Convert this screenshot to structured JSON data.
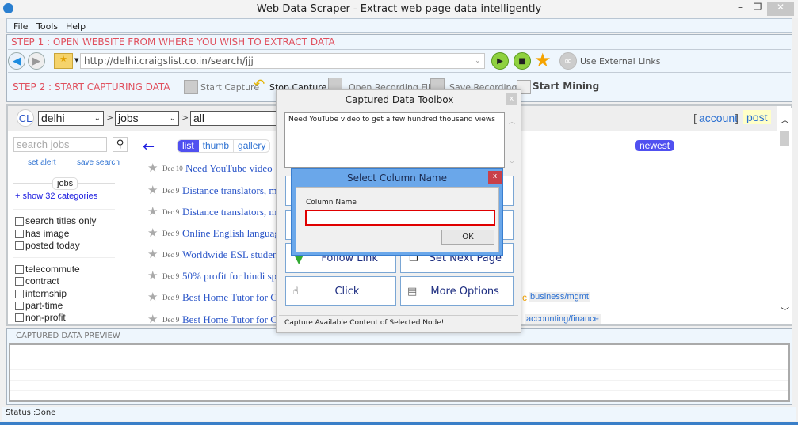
{
  "window": {
    "title": "Web Data Scraper -  Extract web page data intelligently"
  },
  "menu": [
    "File",
    "Tools",
    "Help"
  ],
  "step1": {
    "label": "STEP 1 : OPEN WEBSITE FROM WHERE YOU WISH TO EXTRACT DATA",
    "url": "http://delhi.craigslist.co.in/search/jjj",
    "external_links": "Use External Links"
  },
  "step2": {
    "label": "STEP 2 : START CAPTURING DATA",
    "start_capture": "Start Capture",
    "stop_capture": "Stop Capture",
    "open_recording": "Open Recording File",
    "save_recording": "Save Recording",
    "start_mining": "Start Mining"
  },
  "browser": {
    "logo": "CL",
    "city": "delhi",
    "category": "jobs",
    "sub": "all",
    "sep": ">",
    "account": "account",
    "post": "post",
    "bracket_l": "[",
    "bracket_r": "]",
    "search_placeholder": "search jobs",
    "set_alert": "set alert",
    "save_search": "save search",
    "jobs_pill": "jobs",
    "show_categories": "+ show 32 categories",
    "filters1": [
      "search titles only",
      "has image",
      "posted today"
    ],
    "filters2": [
      "telecommute",
      "contract",
      "internship",
      "part-time",
      "non-profit"
    ],
    "back_arrow": "←",
    "views": [
      "list",
      "thumb",
      "gallery"
    ],
    "sort": "newest",
    "rows": [
      {
        "date": "Dec 10",
        "title": "Need YouTube video t"
      },
      {
        "date": "Dec 9",
        "title": "Distance translators, mu"
      },
      {
        "date": "Dec 9",
        "title": "Distance translators, mu"
      },
      {
        "date": "Dec 9",
        "title": "Online English languag"
      },
      {
        "date": "Dec 9",
        "title": "Worldwide ESL studen"
      },
      {
        "date": "Dec 9",
        "title": "50% profit for hindi spe"
      },
      {
        "date": "Dec 9",
        "title": "Best Home Tutor for Cl"
      },
      {
        "date": "Dec 9",
        "title": "Best Home Tutor for Cl"
      }
    ],
    "tags": {
      "c": "c",
      "business": "business/mgmt",
      "accounting": "accounting/finance"
    }
  },
  "preview": {
    "label": "CAPTURED DATA PREVIEW"
  },
  "status": {
    "label": "Status :",
    "value": "Done"
  },
  "toolbox": {
    "title": "Captured Data Toolbox",
    "close": "x",
    "text": "Need YouTube video to get a few hundred thousand views",
    "follow_link": "Follow Link",
    "set_next_page": "Set Next Page",
    "click": "Click",
    "more_options": "More Options",
    "status": "Capture Available Content of Selected Node!"
  },
  "column_dialog": {
    "title": "Select Column Name",
    "close": "x",
    "label": "Column Name",
    "value": "",
    "ok": "OK"
  },
  "colors": {
    "step": "#e0505e",
    "link": "#2a6fd1",
    "accent": "#5050f0",
    "dialog": "#6aa7ea",
    "error_border": "#e00000"
  }
}
